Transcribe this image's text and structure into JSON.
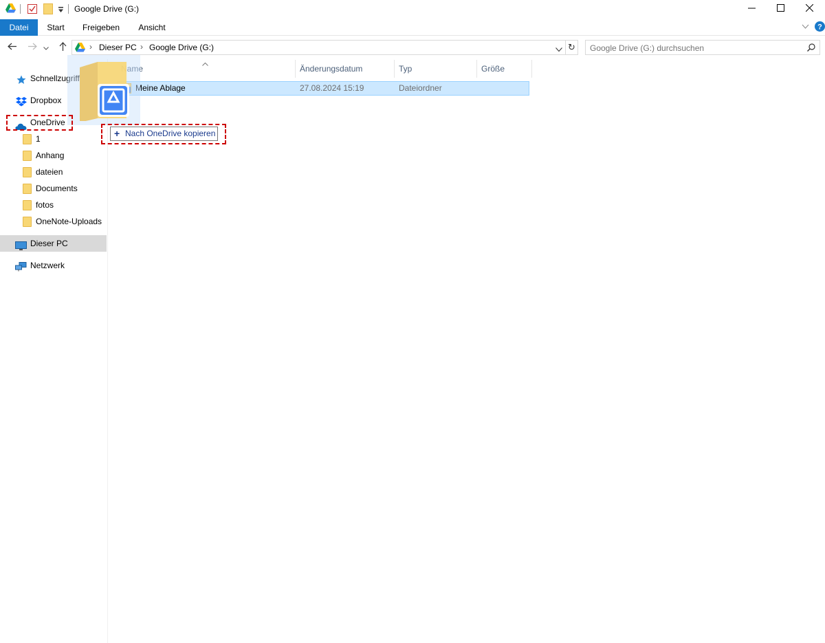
{
  "window": {
    "title": "Google Drive (G:)",
    "controls": [
      "minimize",
      "maximize",
      "close"
    ]
  },
  "ribbon": {
    "tabs": [
      "Datei",
      "Start",
      "Freigeben",
      "Ansicht"
    ]
  },
  "address": {
    "crumbs": [
      "Dieser PC",
      "Google Drive (G:)"
    ]
  },
  "search": {
    "placeholder": "Google Drive (G:) durchsuchen"
  },
  "nav": {
    "quick_access": "Schnellzugriff",
    "dropbox": "Dropbox",
    "onedrive": "OneDrive",
    "onedrive_children": [
      "1",
      "Anhang",
      "dateien",
      "Documents",
      "fotos",
      "OneNote-Uploads"
    ],
    "this_pc": "Dieser PC",
    "network": "Netzwerk"
  },
  "columns": {
    "name": "Name",
    "date": "Änderungsdatum",
    "type": "Typ",
    "size": "Größe"
  },
  "rows": [
    {
      "name": "Meine Ablage",
      "date": "27.08.2024 15:19",
      "type": "Dateiordner",
      "size": ""
    }
  ],
  "drag": {
    "tooltip": "Nach OneDrive kopieren"
  },
  "colors": {
    "accent": "#1979ca",
    "selection": "#cce8ff",
    "highlight": "#cc0000"
  }
}
